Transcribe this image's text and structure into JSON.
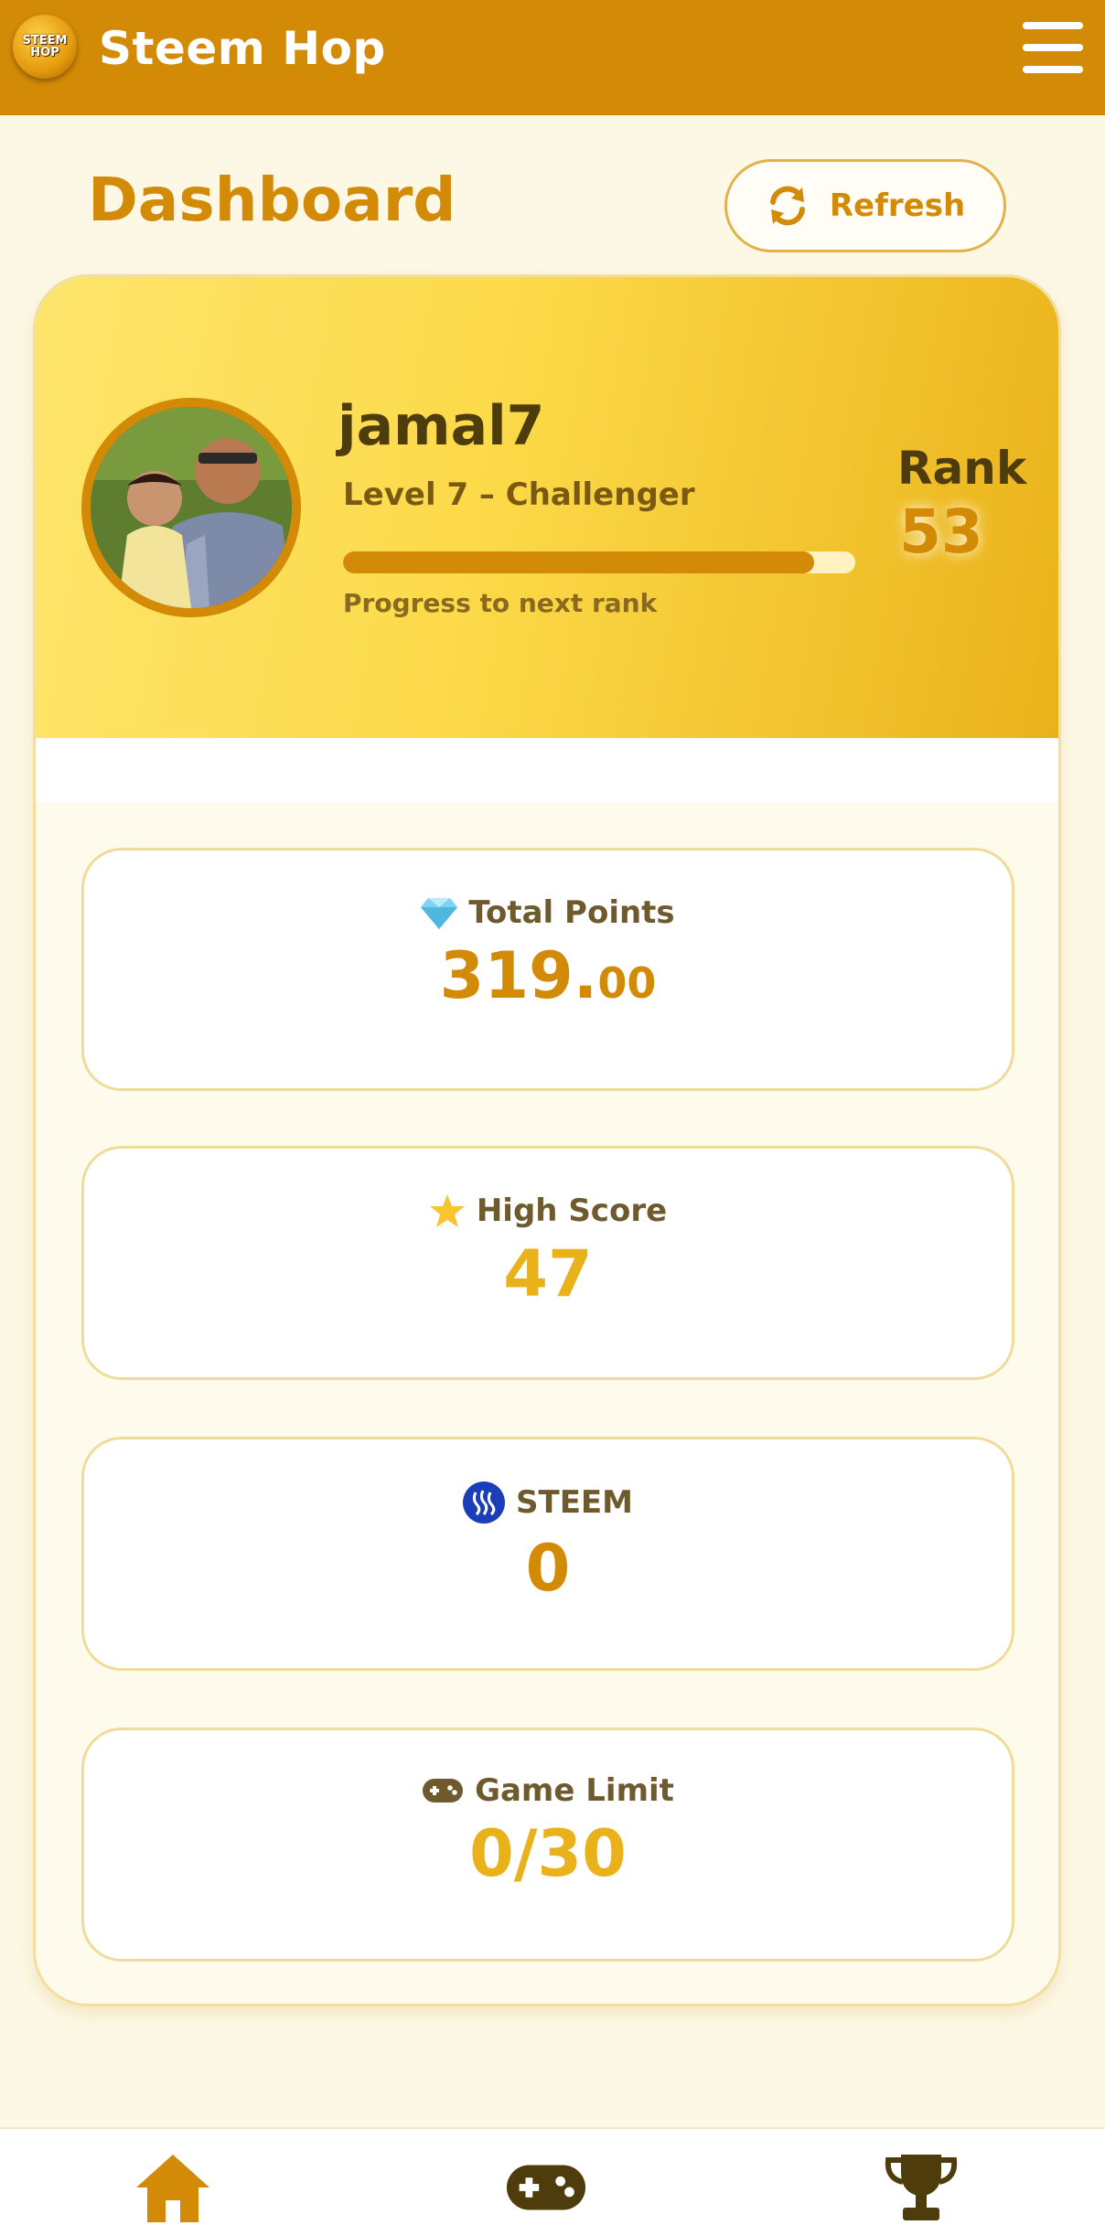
{
  "app": {
    "title": "Steem Hop",
    "logo_line1": "STEEM",
    "logo_line2": "HOP"
  },
  "page": {
    "title": "Dashboard",
    "refresh_label": "Refresh"
  },
  "profile": {
    "username": "jamal7",
    "level": "Level 7 – Challenger",
    "progress_fraction": 0.92,
    "progress_label": "Progress to next rank",
    "rank_label": "Rank",
    "rank_value": "53"
  },
  "stats": {
    "points": {
      "label": "Total Points",
      "value_int": "319.",
      "value_dec": "00",
      "icon": "gem-icon"
    },
    "high_score": {
      "label": "High Score",
      "value": "47",
      "icon": "star-icon"
    },
    "steem": {
      "label": "STEEM",
      "value": "0",
      "icon": "steem-icon"
    },
    "game_limit": {
      "label": "Game Limit",
      "value": "0/30",
      "icon": "gamepad-icon"
    }
  },
  "colors": {
    "primary": "#d38a06",
    "accent_yellow": "#eab21a",
    "steem_blue": "#1b3db8"
  },
  "nav": {
    "items": [
      "home-icon",
      "gamepad-icon",
      "trophy-icon"
    ]
  }
}
